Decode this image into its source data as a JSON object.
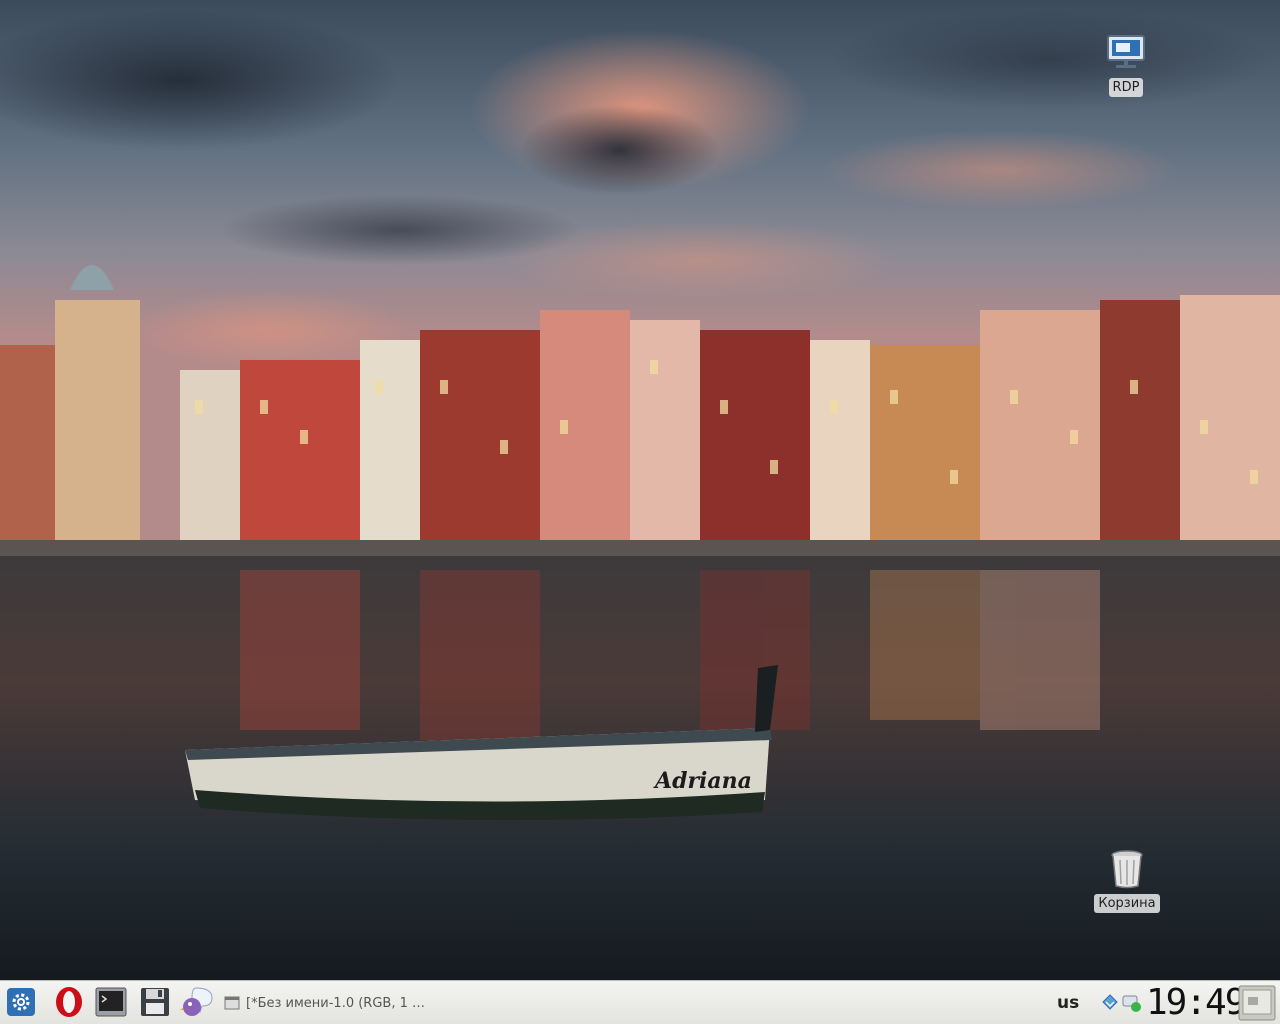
{
  "desktop": {
    "icons": [
      {
        "label": "RDP",
        "icon": "rdp-monitor-icon"
      },
      {
        "label": "Корзина",
        "icon": "trash-icon"
      }
    ],
    "wallpaper": {
      "boat_name": "Adriana"
    }
  },
  "taskbar": {
    "launchers": [
      {
        "name": "settings",
        "icon": "gear-icon"
      },
      {
        "name": "browser",
        "icon": "opera-icon"
      },
      {
        "name": "terminal",
        "icon": "terminal-icon"
      },
      {
        "name": "save",
        "icon": "floppy-disk-icon"
      },
      {
        "name": "messenger",
        "icon": "pidgin-icon"
      }
    ],
    "task": {
      "title": "[*Без имени-1.0 (RGB, 1 …"
    },
    "keyboard_layout": "us",
    "clock": "19:49",
    "colors": {
      "accent_blue": "#2f6fb3",
      "opera_red": "#cc0f16"
    }
  }
}
